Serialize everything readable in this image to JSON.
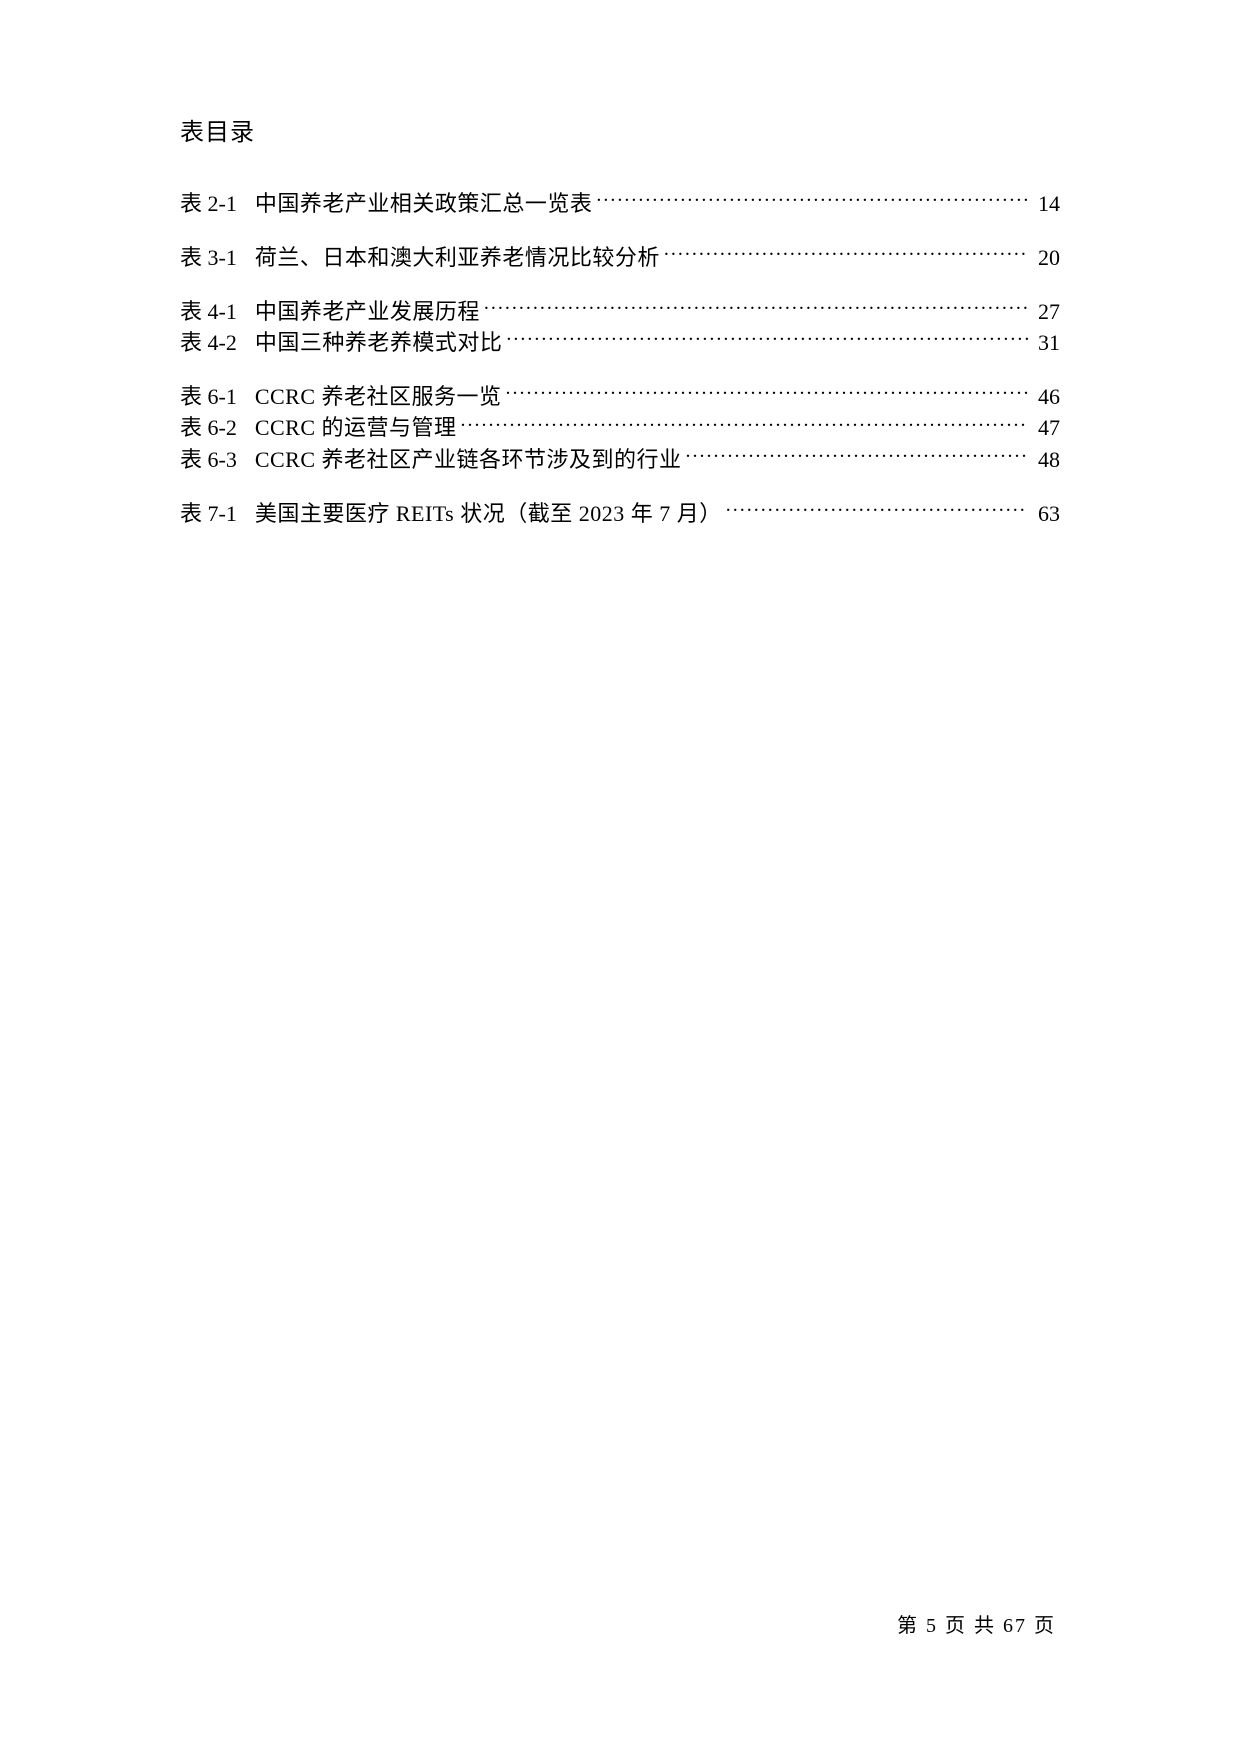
{
  "title": "表目录",
  "groups": [
    {
      "entries": [
        {
          "label": "表 2-1",
          "caption": "中国养老产业相关政策汇总一览表",
          "page": "14"
        }
      ]
    },
    {
      "entries": [
        {
          "label": "表 3-1",
          "caption": "荷兰、日本和澳大利亚养老情况比较分析",
          "page": "20"
        }
      ]
    },
    {
      "entries": [
        {
          "label": "表 4-1",
          "caption": "中国养老产业发展历程",
          "page": "27"
        },
        {
          "label": "表 4-2",
          "caption": "中国三种养老养模式对比",
          "page": "31"
        }
      ]
    },
    {
      "entries": [
        {
          "label": "表 6-1",
          "caption": "CCRC 养老社区服务一览",
          "page": "46"
        },
        {
          "label": "表 6-2",
          "caption": "CCRC 的运营与管理",
          "page": "47"
        },
        {
          "label": "表 6-3",
          "caption": "CCRC 养老社区产业链各环节涉及到的行业",
          "page": "48"
        }
      ]
    },
    {
      "entries": [
        {
          "label": "表 7-1",
          "caption": "美国主要医疗 REITs 状况（截至 2023 年 7 月）",
          "page": "63"
        }
      ]
    }
  ],
  "footer": "第 5 页 共 67 页"
}
